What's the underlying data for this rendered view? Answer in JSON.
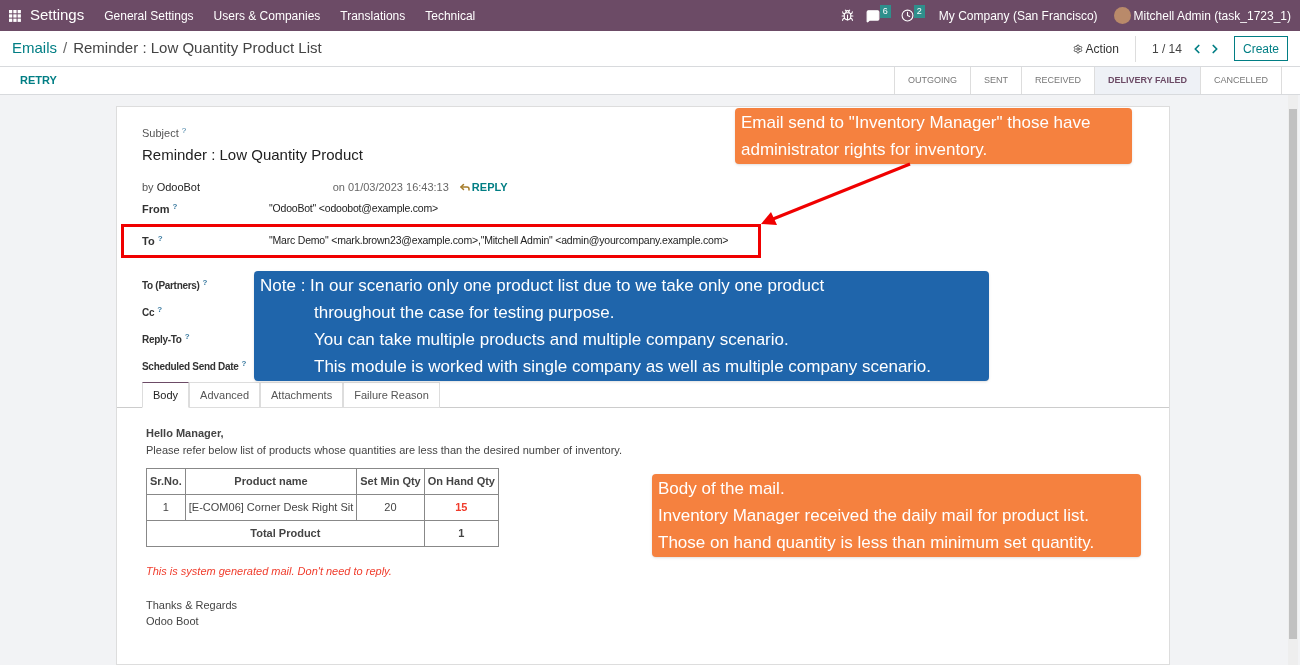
{
  "navbar": {
    "app": "Settings",
    "menus": [
      "General Settings",
      "Users & Companies",
      "Translations",
      "Technical"
    ],
    "messages_count": "6",
    "activities_count": "2",
    "company": "My Company (San Francisco)",
    "user": "Mitchell Admin (task_1723_1)"
  },
  "breadcrumb": {
    "parent": "Emails",
    "separator": "/",
    "current": "Reminder : Low Quantity Product List"
  },
  "control_panel": {
    "action": "Action",
    "pager": "1 / 14",
    "create": "Create"
  },
  "retry": "RETRY",
  "statuses": [
    {
      "label": "OUTGOING",
      "selected": false
    },
    {
      "label": "SENT",
      "selected": false
    },
    {
      "label": "RECEIVED",
      "selected": false
    },
    {
      "label": "DELIVERY FAILED",
      "selected": true
    },
    {
      "label": "CANCELLED",
      "selected": false
    }
  ],
  "subject": {
    "label": "Subject",
    "help": "?",
    "value": "Reminder : Low Quantity Product"
  },
  "author": {
    "prefix": "by",
    "name": "OdooBot",
    "date": "on 01/03/2023 16:43:13",
    "reply": "REPLY"
  },
  "fields": [
    {
      "label": "From",
      "help": "?",
      "value": "\"OdooBot\" <odoobot@example.com>",
      "highlighted": false
    },
    {
      "label": "To",
      "help": "?",
      "value": "\"Marc Demo\" <mark.brown23@example.com>,\"Mitchell Admin\" <admin@yourcompany.example.com>",
      "highlighted": true
    }
  ],
  "more_fields": [
    {
      "label": "To (Partners)",
      "help": "?"
    },
    {
      "label": "Cc",
      "help": "?"
    },
    {
      "label": "Reply-To",
      "help": "?"
    },
    {
      "label": "Scheduled Send Date",
      "help": "?"
    }
  ],
  "tabs": [
    {
      "label": "Body",
      "selected": true
    },
    {
      "label": "Advanced",
      "selected": false
    },
    {
      "label": "Attachments",
      "selected": false
    },
    {
      "label": "Failure Reason",
      "selected": false
    }
  ],
  "body": {
    "greeting": "Hello Manager,",
    "intro": "Please refer below list of products whose quantities are less than the desired number of inventory.",
    "table": {
      "columns": [
        "Sr.No.",
        "Product name",
        "Set Min Qty",
        "On Hand Qty"
      ],
      "rows": [
        {
          "sr": "1",
          "product": "[E-COM06] Corner Desk Right Sit",
          "min_qty": "20",
          "on_hand": "15",
          "below_min": true
        }
      ],
      "total": {
        "label": "Total Product",
        "value": "1"
      }
    },
    "notice": "This is system generated mail. Don't need to reply.",
    "closing": "Thanks & Regards",
    "signature": "Odoo Boot"
  },
  "callouts": [
    {
      "color": "#f5813f",
      "lines": [
        {
          "text": "Email send to \"Inventory Manager\" those have",
          "indent": false
        },
        {
          "text": "administrator rights for inventory.",
          "indent": false
        }
      ]
    },
    {
      "color": "#1f65ab",
      "lines": [
        {
          "text": "Note : In our scenario only one product list due to we take only one product",
          "indent": false
        },
        {
          "text": "throughout the case for testing purpose.",
          "indent": true
        },
        {
          "text": "You can take multiple products and multiple company scenario.",
          "indent": true
        },
        {
          "text": "This module is worked with single company as well as multiple company scenario.",
          "indent": true
        }
      ]
    },
    {
      "color": "#f5813f",
      "lines": [
        {
          "text": "Body of the mail.",
          "indent": false
        },
        {
          "text": "Inventory Manager received the daily mail for product list.",
          "indent": false
        },
        {
          "text": "Those on hand quantity is less than minimum set quantity.",
          "indent": false
        }
      ]
    }
  ]
}
